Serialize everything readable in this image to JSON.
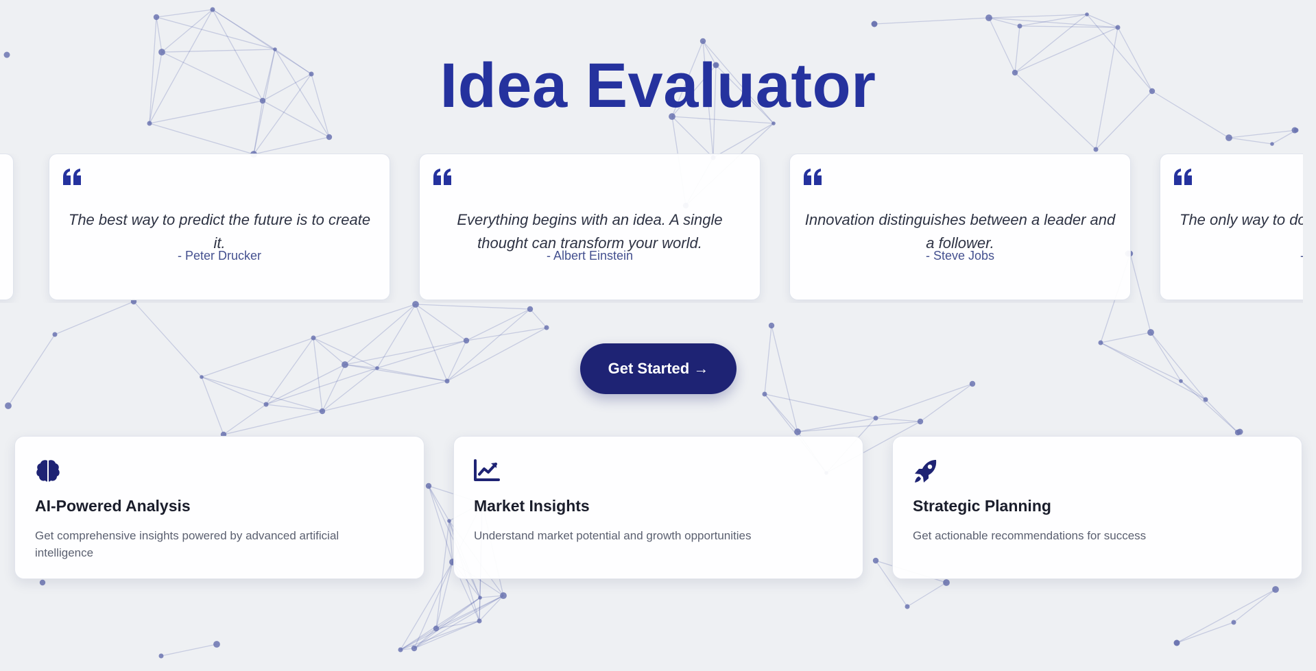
{
  "app": {
    "title": "Idea Evaluator"
  },
  "colors": {
    "background": "#eef0f3",
    "title": "#25329e",
    "accent": "#1e2374",
    "network_line": "#3d4a9e",
    "network_node": "#6b74b0"
  },
  "quotes": [
    {
      "text": "",
      "author": ""
    },
    {
      "text": "The best way to predict the future is to create it.",
      "author": "- Peter Drucker"
    },
    {
      "text": "Everything begins with an idea. A single thought can transform your world.",
      "author": "- Albert Einstein"
    },
    {
      "text": "Innovation distinguishes between a leader and a follower.",
      "author": "- Steve Jobs"
    },
    {
      "text": "The only way to do",
      "author": "-"
    }
  ],
  "cta": {
    "label": "Get Started →"
  },
  "features": [
    {
      "icon": "brain-icon",
      "title": "AI-Powered Analysis",
      "description": "Get comprehensive insights powered by advanced artificial intelligence"
    },
    {
      "icon": "chart-line-icon",
      "title": "Market Insights",
      "description": "Understand market potential and growth opportunities"
    },
    {
      "icon": "rocket-icon",
      "title": "Strategic Planning",
      "description": "Get actionable recommendations for success"
    }
  ]
}
